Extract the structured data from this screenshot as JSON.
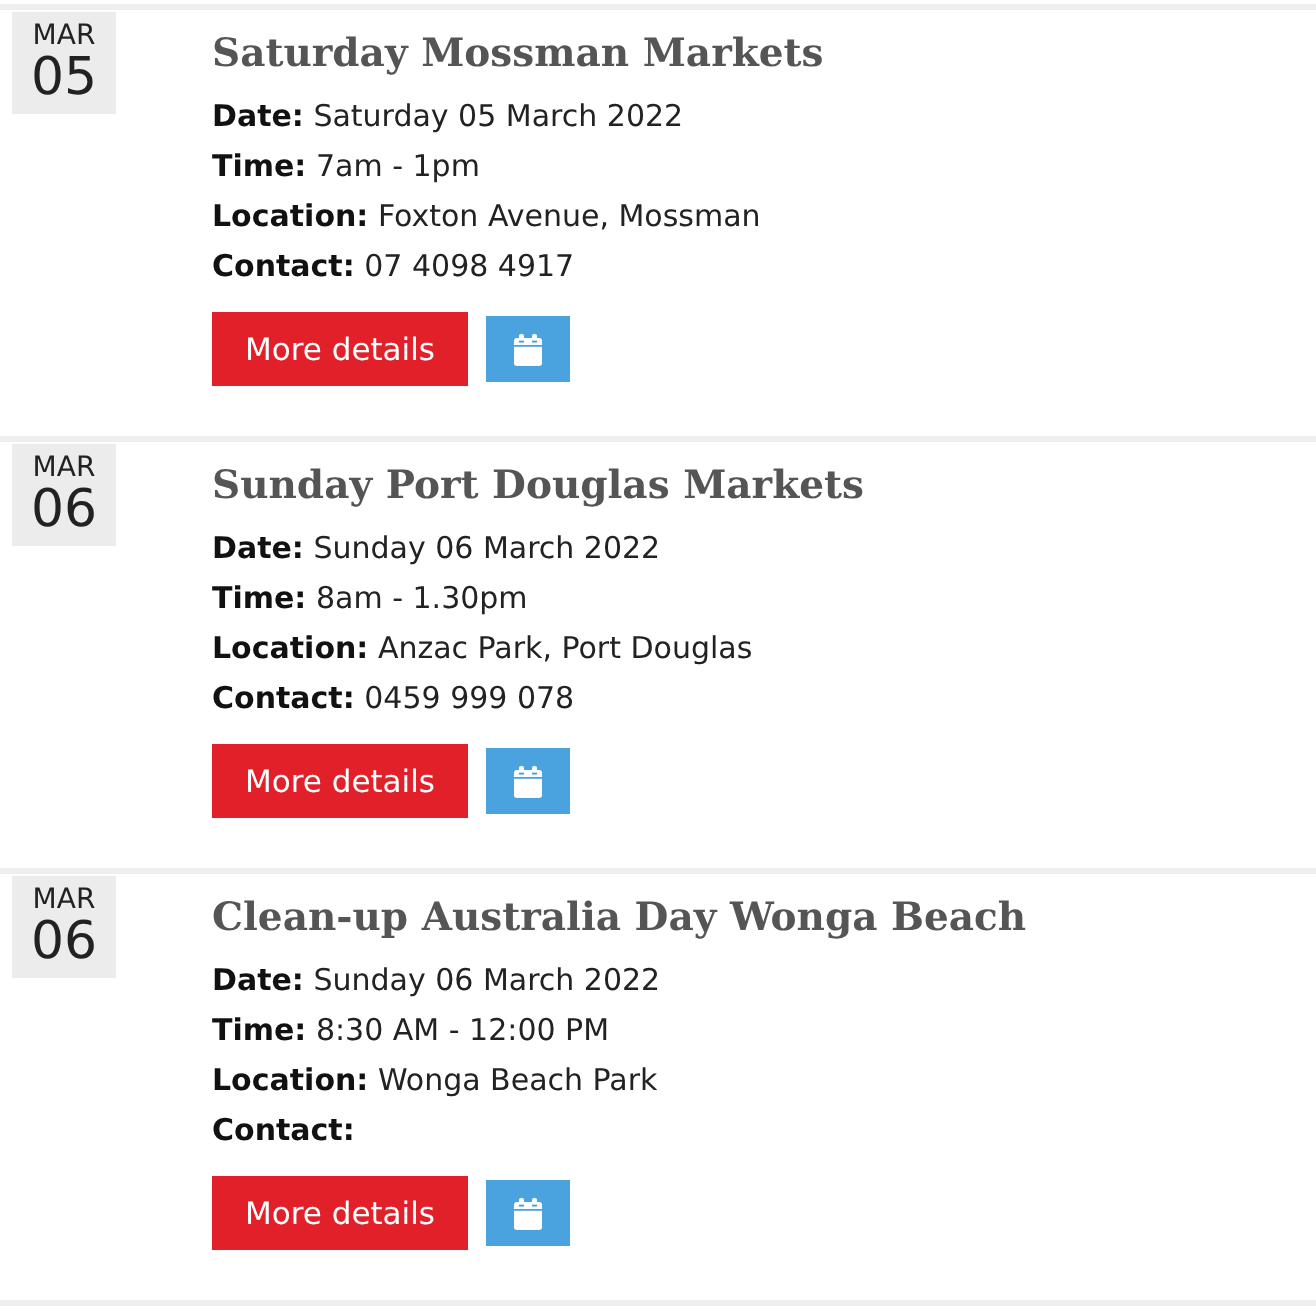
{
  "events": [
    {
      "month": "MAR",
      "day": "05",
      "title": "Saturday Mossman Markets",
      "fields": [
        {
          "label": "Date:",
          "value": "Saturday 05 March 2022"
        },
        {
          "label": "Time:",
          "value": "7am - 1pm"
        },
        {
          "label": "Location:",
          "value": "Foxton Avenue, Mossman"
        },
        {
          "label": "Contact:",
          "value": "07 4098 4917"
        }
      ],
      "details_button": "More details"
    },
    {
      "month": "MAR",
      "day": "06",
      "title": "Sunday Port Douglas Markets",
      "fields": [
        {
          "label": "Date:",
          "value": "Sunday 06 March 2022"
        },
        {
          "label": "Time:",
          "value": "8am - 1.30pm"
        },
        {
          "label": "Location:",
          "value": "Anzac Park, Port Douglas"
        },
        {
          "label": "Contact:",
          "value": "0459 999 078"
        }
      ],
      "details_button": "More details"
    },
    {
      "month": "MAR",
      "day": "06",
      "title": "Clean-up Australia Day Wonga Beach",
      "fields": [
        {
          "label": "Date:",
          "value": "Sunday 06 March 2022"
        },
        {
          "label": "Time:",
          "value": "8:30 AM - 12:00 PM"
        },
        {
          "label": "Location:",
          "value": "Wonga Beach Park"
        },
        {
          "label": "Contact:"
        }
      ],
      "details_button": "More details"
    }
  ]
}
